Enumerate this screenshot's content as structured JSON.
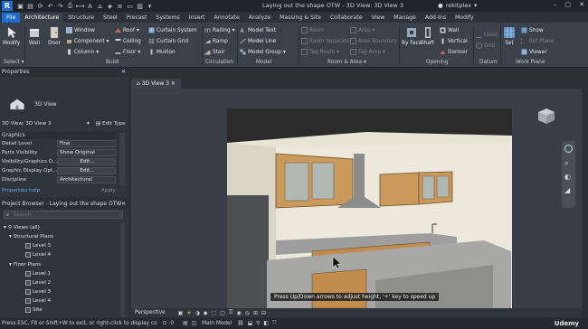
{
  "app": {
    "logo_letter": "R",
    "title": "Laying out the shape OTW - 3D View: 3D View 3",
    "user": "rekitplex"
  },
  "tabs": [
    "File",
    "Architecture",
    "Structure",
    "Steel",
    "Precast",
    "Systems",
    "Insert",
    "Annotate",
    "Analyze",
    "Massing & Site",
    "Collaborate",
    "View",
    "Manage",
    "Add-Ins",
    "Modify"
  ],
  "ribbon": {
    "modify": "Modify",
    "wall": "Wall",
    "door": "Door",
    "window": "Window",
    "component": "Component",
    "column": "Column",
    "roof": "Roof",
    "ceiling": "Ceiling",
    "floor": "Floor",
    "curtain_system": "Curtain System",
    "curtain_grid": "Curtain Grid",
    "mullion": "Mullion",
    "railing": "Railing",
    "ramp": "Ramp",
    "stair": "Stair",
    "model_text": "Model Text",
    "model_line": "Model Line",
    "model_group": "Model Group",
    "room": "Room",
    "room_separator": "Room Separator",
    "tag_room": "Tag Room",
    "area": "Area",
    "area_boundary": "Area Boundary",
    "tag_area": "Tag Area",
    "by_face": "By Face",
    "shaft": "Shaft",
    "wall_open": "Wall",
    "vertical": "Vertical",
    "dormer": "Dormer",
    "level": "Level",
    "grid": "Grid",
    "set": "Set",
    "show": "Show",
    "ref_plane": "Ref Plane",
    "viewer": "Viewer",
    "panels": {
      "select": "Select",
      "build": "Build",
      "circulation": "Circulation",
      "model": "Model",
      "room_area": "Room & Area",
      "opening": "Opening",
      "datum": "Datum",
      "work_plane": "Work Plane"
    }
  },
  "properties": {
    "header": "Properties",
    "type_name": "3D View",
    "selector": "3D View: 3D View 3",
    "edit_type": "Edit Type",
    "section": "Graphics",
    "rows": [
      {
        "k": "Detail Level",
        "v": "Fine"
      },
      {
        "k": "Parts Visibility",
        "v": "Show Original"
      },
      {
        "k": "Visibility/Graphics O...",
        "v": "Edit..."
      },
      {
        "k": "Graphic Display Opt...",
        "v": "Edit..."
      },
      {
        "k": "Discipline",
        "v": "Architectural"
      }
    ],
    "help": "Properties help",
    "apply": "Apply"
  },
  "browser": {
    "header": "Project Browser - Laying out the shape OTW",
    "search_placeholder": "Search",
    "items": [
      {
        "label": "Views (all)"
      },
      {
        "label": "Structural Plans"
      },
      {
        "label": "Level 3"
      },
      {
        "label": "Level 4"
      },
      {
        "label": "Floor Plans"
      },
      {
        "label": "Level 1"
      },
      {
        "label": "Level 2"
      },
      {
        "label": "Level 3"
      },
      {
        "label": "Level 4"
      },
      {
        "label": "Site"
      }
    ]
  },
  "view": {
    "tab": "3D View 3",
    "mode": "Perspective",
    "hint": "Press Up/Down arrows to adjust height, '+' key to speed up"
  },
  "status": {
    "text": "Press ESC, F8 or Shift+W to exit, or right-click to display co",
    "zero": ":0",
    "model": "Main Model",
    "watermark": "Udemy"
  }
}
